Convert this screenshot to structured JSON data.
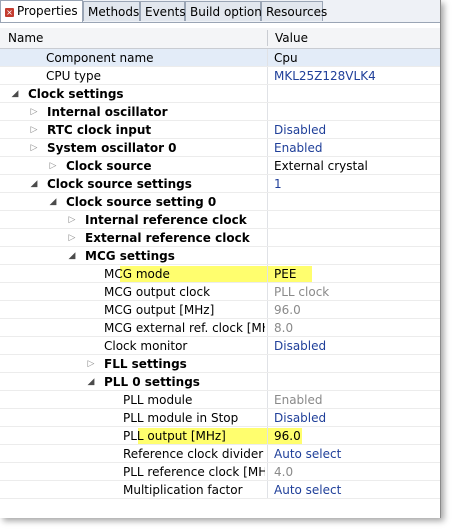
{
  "tabs": [
    {
      "label": "Properties",
      "active": true
    },
    {
      "label": "Methods",
      "active": false
    },
    {
      "label": "Events",
      "active": false
    },
    {
      "label": "Build options",
      "active": false
    },
    {
      "label": "Resources",
      "active": false
    }
  ],
  "table": {
    "col_name": "Name",
    "col_value": "Value"
  },
  "rows": [
    {
      "name": "Component name",
      "value": "Cpu"
    },
    {
      "name": "CPU type",
      "value": "MKL25Z128VLK4"
    },
    {
      "name": "Clock settings",
      "value": ""
    },
    {
      "name": "Internal oscillator",
      "value": ""
    },
    {
      "name": "RTC clock input",
      "value": "Disabled"
    },
    {
      "name": "System oscillator 0",
      "value": "Enabled"
    },
    {
      "name": "Clock source",
      "value": "External crystal"
    },
    {
      "name": "Clock source settings",
      "value": "1"
    },
    {
      "name": "Clock source setting 0",
      "value": ""
    },
    {
      "name": "Internal reference clock",
      "value": ""
    },
    {
      "name": "External reference clock",
      "value": ""
    },
    {
      "name": "MCG settings",
      "value": ""
    },
    {
      "name": "MCG mode",
      "value": "PEE"
    },
    {
      "name": "MCG output clock",
      "value": "PLL clock"
    },
    {
      "name": "MCG output [MHz]",
      "value": "96.0"
    },
    {
      "name": "MCG external ref. clock [MH",
      "value": "8.0"
    },
    {
      "name": "Clock monitor",
      "value": "Disabled"
    },
    {
      "name": "FLL settings",
      "value": ""
    },
    {
      "name": "PLL 0 settings",
      "value": ""
    },
    {
      "name": "PLL module",
      "value": "Enabled"
    },
    {
      "name": "PLL module in Stop",
      "value": "Disabled"
    },
    {
      "name": "PLL output [MHz]",
      "value": "96.0"
    },
    {
      "name": "Reference clock divider",
      "value": "Auto select"
    },
    {
      "name": "PLL reference clock [MH",
      "value": "4.0"
    },
    {
      "name": "Multiplication factor",
      "value": "Auto select"
    }
  ],
  "colors": {
    "highlight": "#fffe6e",
    "value_blue": "#1f3f99",
    "value_grey": "#8a8a8a",
    "selected_row": "#e3ecf8",
    "tab_icon": "#c43c2f"
  },
  "icons": {
    "properties_tab": "properties-x-icon",
    "expanded": "triangle-down-icon",
    "collapsed": "triangle-right-icon"
  }
}
